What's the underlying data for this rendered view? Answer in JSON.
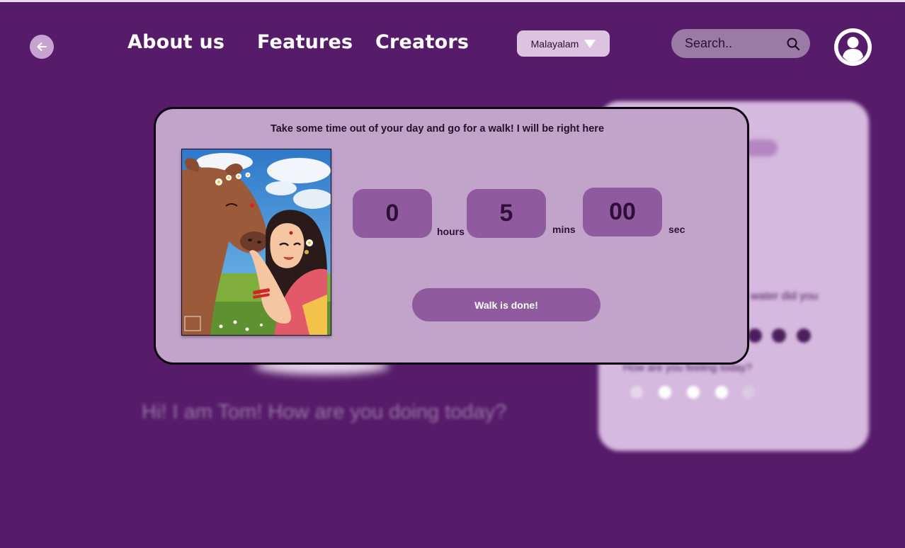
{
  "header": {
    "nav": [
      "About us",
      "Features",
      "Creators"
    ],
    "language": "Malayalam",
    "search_placeholder": "Search.."
  },
  "background": {
    "greeting": "Hi! I am Tom! How are you doing today?",
    "card_question_1": "water did you",
    "card_question_2": "How are you feeling today?"
  },
  "modal": {
    "message": "Take some time out of your day and go for a walk! I will be right here",
    "timer": {
      "hours": "0",
      "hours_label": "hours",
      "mins": "5",
      "mins_label": "mins",
      "sec": "00",
      "sec_label": "sec"
    },
    "done_label": "Walk is done!"
  },
  "colors": {
    "background": "#561b69",
    "modal": "#c2a4cb",
    "timer_box": "#8f5b9e",
    "language_pill": "#dcc4e1"
  },
  "icons": [
    "back-arrow-icon",
    "dropdown-triangle-icon",
    "search-icon",
    "user-avatar-icon"
  ]
}
